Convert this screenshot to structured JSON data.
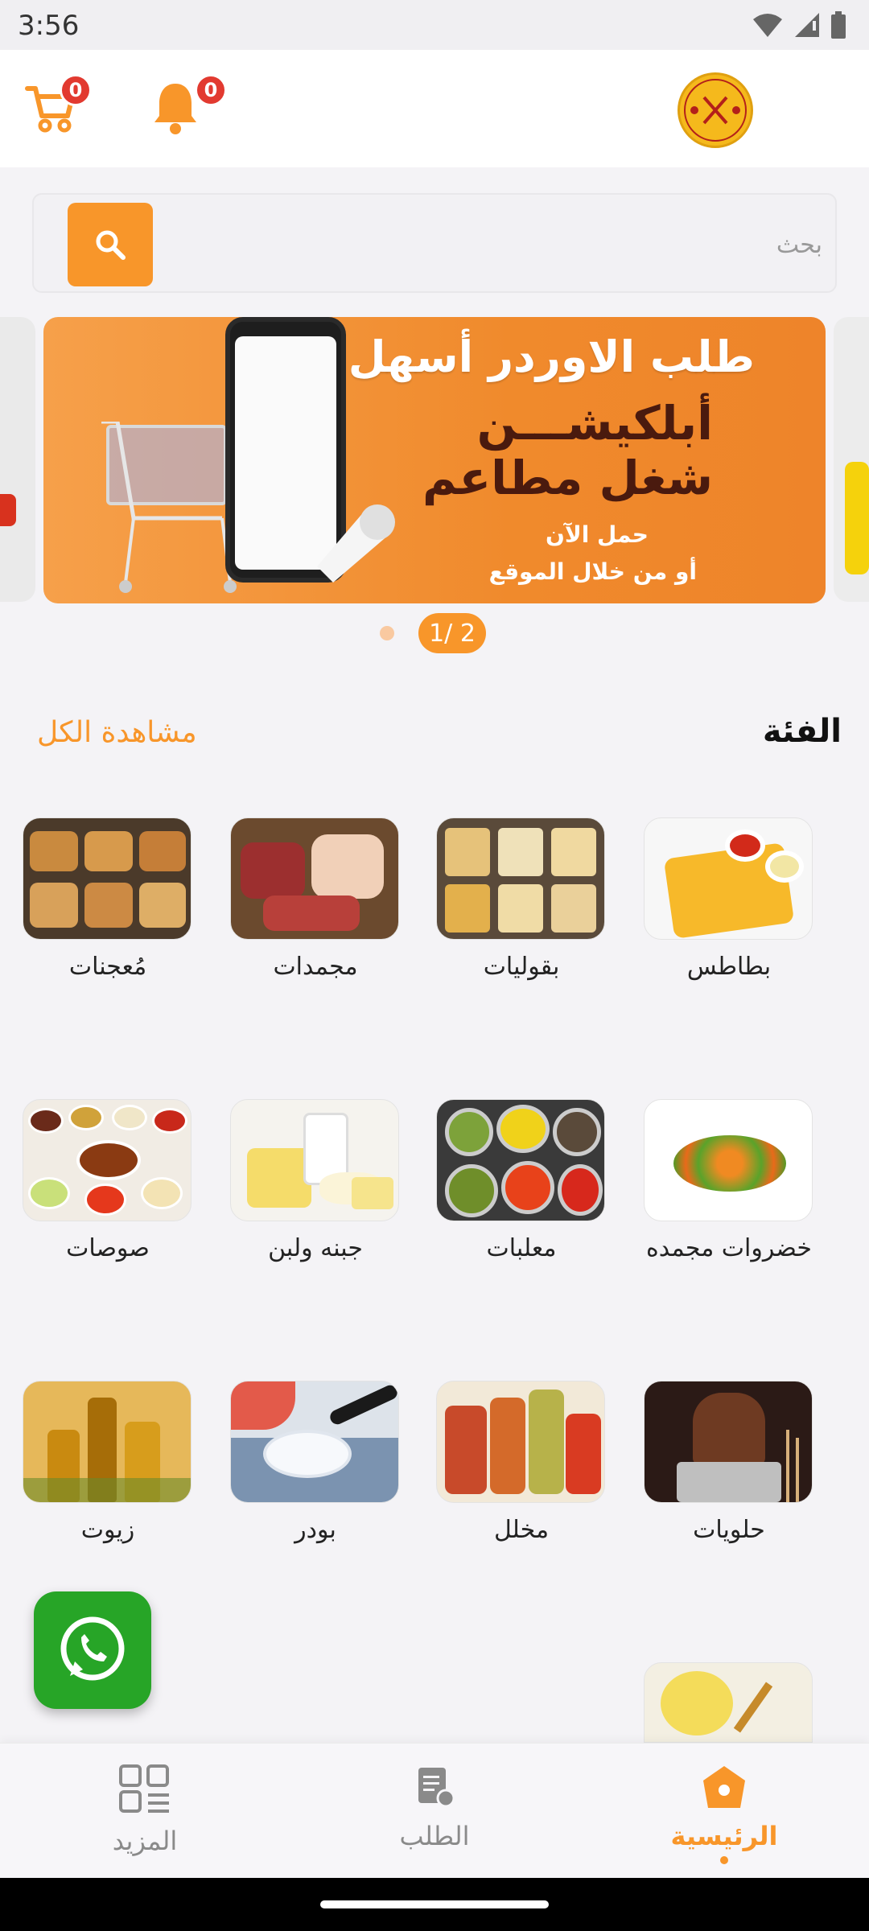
{
  "status_bar": {
    "time": "3:56",
    "icons": [
      "wifi-icon",
      "signal-icon",
      "battery-icon"
    ]
  },
  "header": {
    "cart_count": "0",
    "notification_count": "0",
    "logo_icon": "mh-shagl-mataem-logo"
  },
  "search": {
    "placeholder": "بحث"
  },
  "banner": {
    "title": "طلب الاوردر أسهل",
    "line2": "أبلكيشـــن",
    "line3": "شغل مطاعم",
    "line4": "حمل الآن",
    "line5": "أو من خلال الموقع"
  },
  "pager": {
    "label": "2 /1"
  },
  "categories": {
    "title": "الفئة",
    "see_all": "مشاهدة الكل",
    "items": [
      {
        "label": "بطاطس"
      },
      {
        "label": "بقوليات"
      },
      {
        "label": "مجمدات"
      },
      {
        "label": "مُعجنات"
      },
      {
        "label": "خضروات مجمده"
      },
      {
        "label": "معلبات"
      },
      {
        "label": "جبنه ولبن"
      },
      {
        "label": "صوصات"
      },
      {
        "label": "حلويات"
      },
      {
        "label": "مخلل"
      },
      {
        "label": "بودر"
      },
      {
        "label": "زيوت"
      }
    ]
  },
  "bottom_nav": {
    "items": [
      {
        "label": "الرئيسية",
        "icon": "home-icon",
        "active": true
      },
      {
        "label": "الطلب",
        "icon": "orders-icon",
        "active": false
      },
      {
        "label": "المزيد",
        "icon": "grid-icon",
        "active": false
      }
    ]
  },
  "colors": {
    "accent": "#f8962a",
    "badge": "#e23a30",
    "whatsapp": "#27a527"
  }
}
